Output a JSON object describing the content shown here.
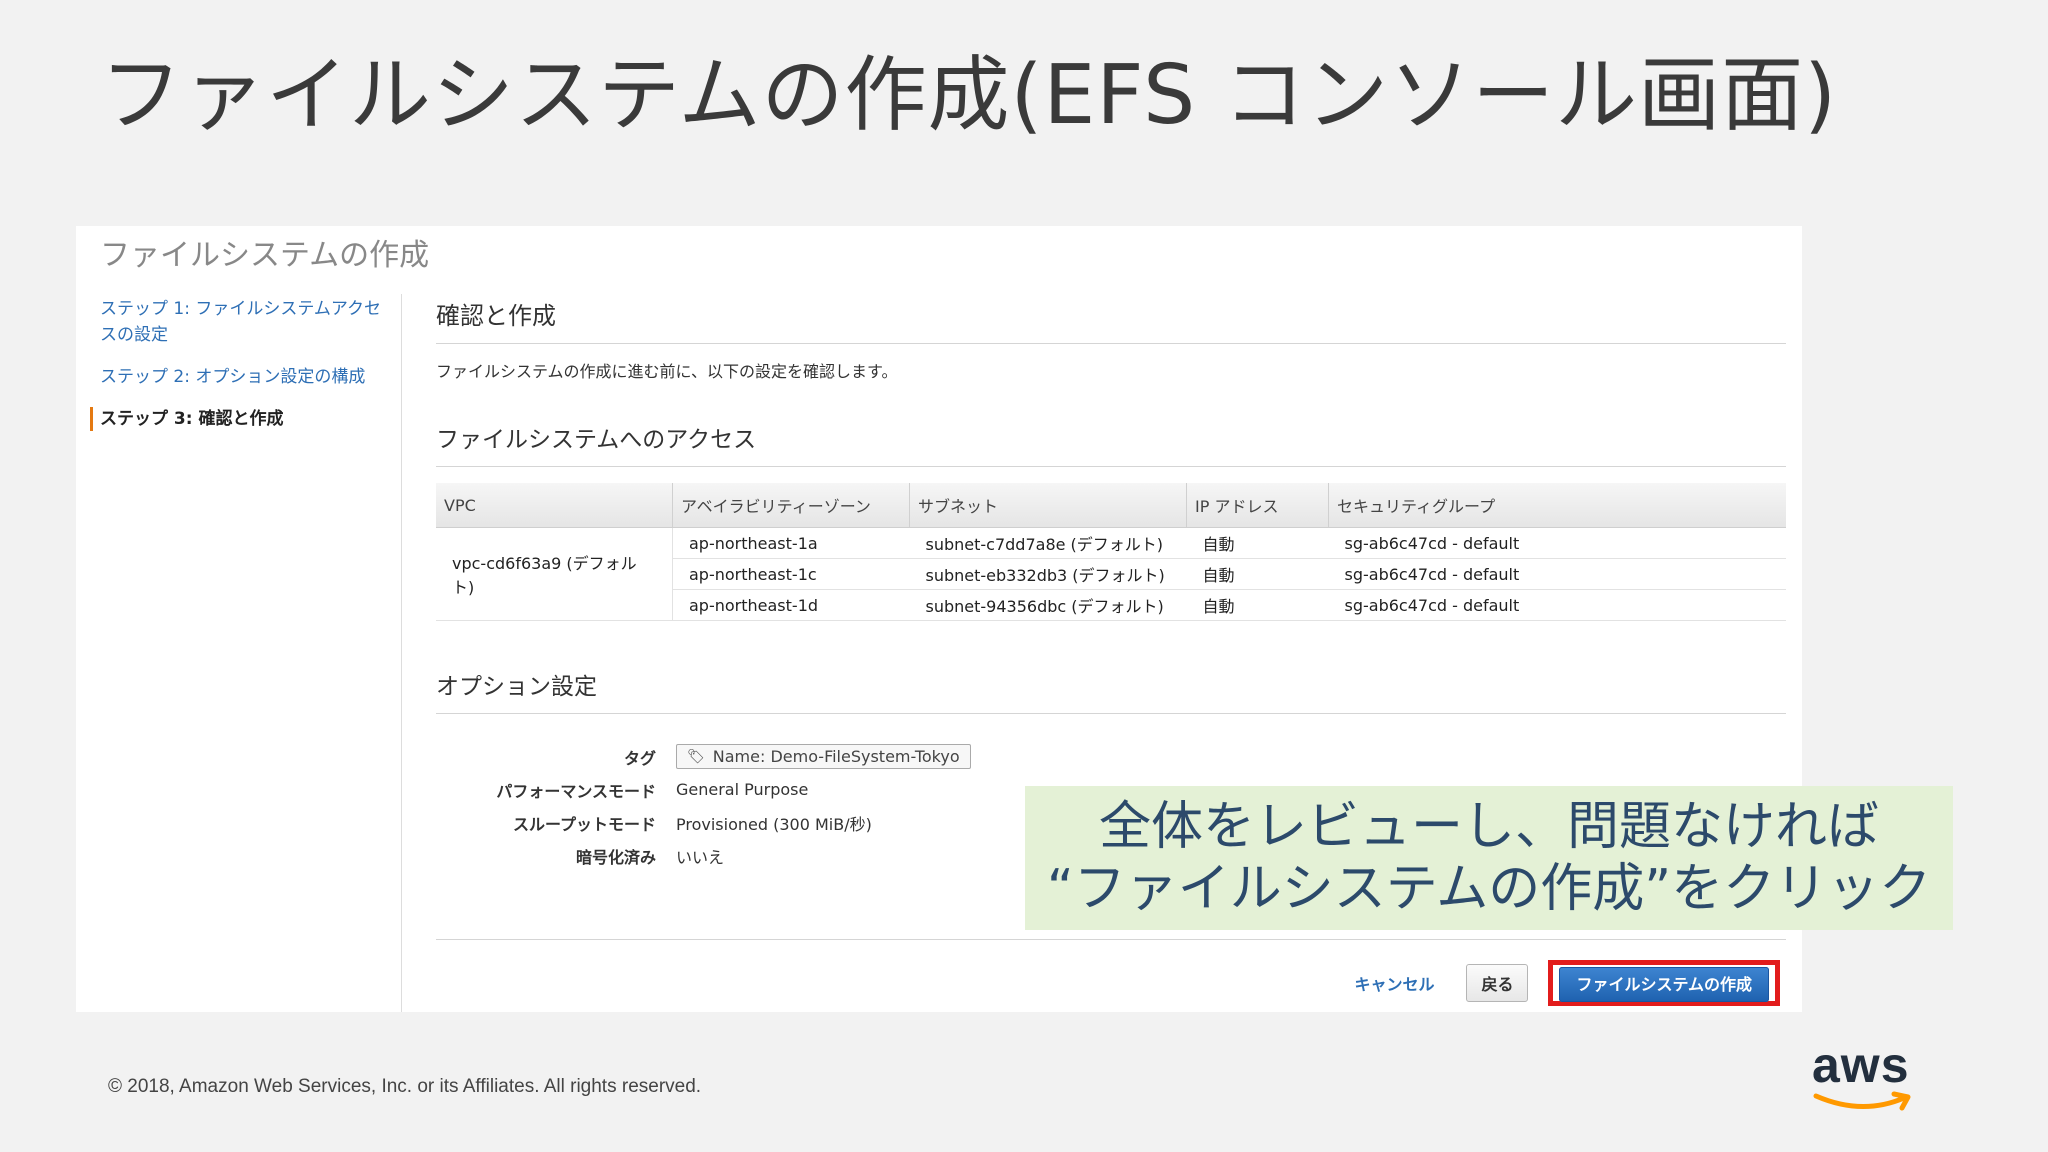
{
  "slide": {
    "title": "ファイルシステムの作成(EFS コンソール画面)",
    "footer": "© 2018, Amazon Web Services, Inc. or its Affiliates. All rights reserved.",
    "logo_text": "aws"
  },
  "panel": {
    "title": "ファイルシステムの作成",
    "nav": [
      {
        "label": "ステップ 1: ファイルシステムアクセスの設定",
        "active": false
      },
      {
        "label": "ステップ 2: オプション設定の構成",
        "active": false
      },
      {
        "label": "ステップ 3: 確認と作成",
        "active": true
      }
    ],
    "review_heading": "確認と作成",
    "review_desc": "ファイルシステムの作成に進む前に、以下の設定を確認します。",
    "access_heading": "ファイルシステムへのアクセス",
    "access_table": {
      "headers": [
        "VPC",
        "アベイラビリティーゾーン",
        "サブネット",
        "IP アドレス",
        "セキュリティグループ"
      ],
      "vpc": "vpc-cd6f63a9 (デフォルト)",
      "rows": [
        {
          "az": "ap-northeast-1a",
          "subnet": "subnet-c7dd7a8e (デフォルト)",
          "ip": "自動",
          "sg": "sg-ab6c47cd - default"
        },
        {
          "az": "ap-northeast-1c",
          "subnet": "subnet-eb332db3 (デフォルト)",
          "ip": "自動",
          "sg": "sg-ab6c47cd - default"
        },
        {
          "az": "ap-northeast-1d",
          "subnet": "subnet-94356dbc (デフォルト)",
          "ip": "自動",
          "sg": "sg-ab6c47cd - default"
        }
      ]
    },
    "options_heading": "オプション設定",
    "options": {
      "tag_label": "タグ",
      "tag_value": "Name: Demo-FileSystem-Tokyo",
      "perf_label": "パフォーマンスモード",
      "perf_value": "General Purpose",
      "throughput_label": "スループットモード",
      "throughput_value": "Provisioned (300 MiB/秒)",
      "encrypt_label": "暗号化済み",
      "encrypt_value": "いいえ"
    },
    "buttons": {
      "cancel": "キャンセル",
      "back": "戻る",
      "create": "ファイルシステムの作成"
    }
  },
  "callout": {
    "line1": "全体をレビューし、問題なければ",
    "line2": "“ファイルシステムの作成”をクリック"
  },
  "colors": {
    "highlight_border": "#e21c1c",
    "primary_button": "#2a6fbf",
    "callout_bg": "#e4f1d6",
    "active_step_marker": "#e47911"
  }
}
